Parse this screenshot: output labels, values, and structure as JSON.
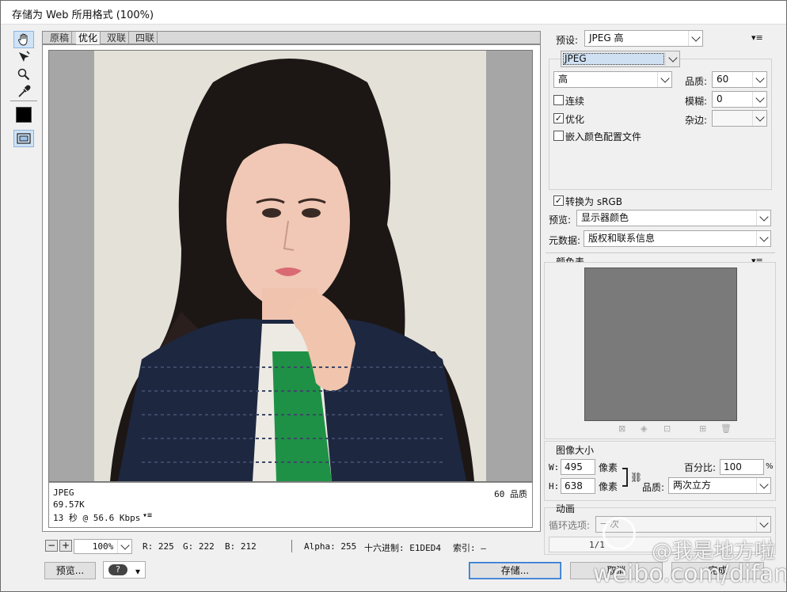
{
  "window": {
    "title": "存储为 Web 所用格式 (100%)"
  },
  "tools": [
    {
      "name": "hand-tool-icon"
    },
    {
      "name": "slice-select-tool-icon"
    },
    {
      "name": "zoom-tool-icon"
    },
    {
      "name": "eyedropper-tool-icon"
    },
    {
      "name": "eyedropper-color-swatch"
    },
    {
      "name": "toggle-slices-icon"
    }
  ],
  "tabs": [
    {
      "label": "原稿",
      "active": false
    },
    {
      "label": "优化",
      "active": true
    },
    {
      "label": "双联",
      "active": false
    },
    {
      "label": "四联",
      "active": false
    }
  ],
  "info": {
    "format": "JPEG",
    "size": "69.57K",
    "time": "13 秒 @ 56.6 Kbps",
    "quality": "60 品质"
  },
  "statusbar": {
    "zoom": "100%",
    "r": "R: 225",
    "g": "G: 222",
    "b": "B: 212",
    "alpha": "Alpha: 255",
    "hex": "十六进制: E1DED4",
    "index": "索引: —"
  },
  "settings": {
    "preset_label": "预设:",
    "preset_value": "JPEG 高",
    "format_value": "JPEG",
    "quality_level": "高",
    "quality_label": "品质:",
    "quality_value": "60",
    "progressive_label": "连续",
    "progressive_checked": false,
    "blur_label": "模糊:",
    "blur_value": "0",
    "optimized_label": "优化",
    "optimized_checked": true,
    "matte_label": "杂边:",
    "matte_value": "",
    "embed_profile_label": "嵌入颜色配置文件",
    "embed_profile_checked": false,
    "convert_srgb_label": "转换为 sRGB",
    "convert_srgb_checked": true,
    "preview_label": "预览:",
    "preview_value": "显示器颜色",
    "metadata_label": "元数据:",
    "metadata_value": "版权和联系信息"
  },
  "color_table": {
    "title": "颜色表"
  },
  "image_size": {
    "title": "图像大小",
    "w_label": "W:",
    "w_value": "495",
    "h_label": "H:",
    "h_value": "638",
    "unit": "像素",
    "percent_label": "百分比:",
    "percent_value": "100",
    "percent_sign": "%",
    "quality_label": "品质:",
    "quality_value": "两次立方"
  },
  "animation": {
    "title": "动画",
    "loop_label": "循环选项:",
    "loop_value": "一次",
    "frame_counter": "1/1"
  },
  "buttons": {
    "preview": "预览...",
    "save": "存储...",
    "cancel": "取消",
    "done": "完成"
  },
  "watermark": {
    "line1": "@我是地方啦",
    "line2": "weibo.com/difangla"
  },
  "colors": {
    "accent": "#2f76c8",
    "sample_hex": "#E1DED4"
  }
}
